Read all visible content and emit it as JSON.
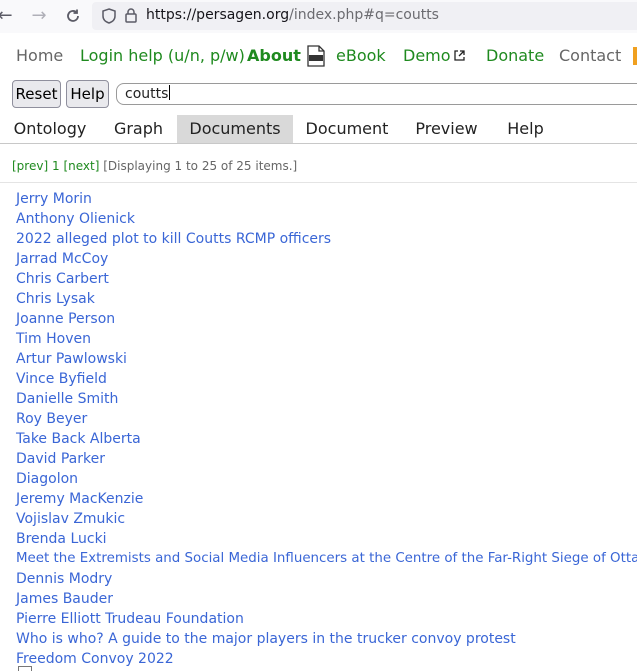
{
  "browser": {
    "url_host": "https://persagen.org",
    "url_path": "/index.php#q=coutts"
  },
  "menu": {
    "home": "Home",
    "login": "Login help (u/n, p/w)",
    "about": "About",
    "ebook": "eBook",
    "demo": "Demo",
    "donate": "Donate",
    "contact": "Contact"
  },
  "search": {
    "reset_label": "Reset",
    "help_label": "Help",
    "query": "coutts"
  },
  "tabs": [
    "Ontology",
    "Graph",
    "Documents",
    "Document",
    "Preview",
    "Help"
  ],
  "active_tab": "Documents",
  "pager": {
    "prev": "[prev]",
    "page": "1",
    "next": "[next]",
    "status": "[Displaying 1 to 25 of 25 items.]"
  },
  "results": [
    "Jerry Morin",
    "Anthony Olienick",
    "2022 alleged plot to kill Coutts RCMP officers",
    "Jarrad McCoy",
    "Chris Carbert",
    "Chris Lysak",
    "Joanne Person",
    "Tim Hoven",
    "Artur Pawlowski",
    "Vince Byfield",
    "Danielle Smith",
    "Roy Beyer",
    "Take Back Alberta",
    "David Parker",
    "Diagolon",
    "Jeremy MacKenzie",
    "Vojislav Zmukic",
    "Brenda Lucki",
    "Meet the Extremists and Social Media Influencers at the Centre of the Far-Right Siege of Ottawa",
    "Dennis Modry",
    "James Bauder",
    "Pierre Elliott Trudeau Foundation",
    "Who is who? A guide to the major players in the trucker convoy protest",
    "Freedom Convoy 2022"
  ],
  "colors": {
    "menu_green": "#1f8a1f",
    "link_blue": "#3a66d6",
    "active_tab_bg": "#d9d9d9"
  },
  "icons": [
    "back-arrow-icon",
    "forward-arrow-icon",
    "reload-icon",
    "shield-icon",
    "lock-icon",
    "pdf-icon",
    "external-link-icon"
  ]
}
